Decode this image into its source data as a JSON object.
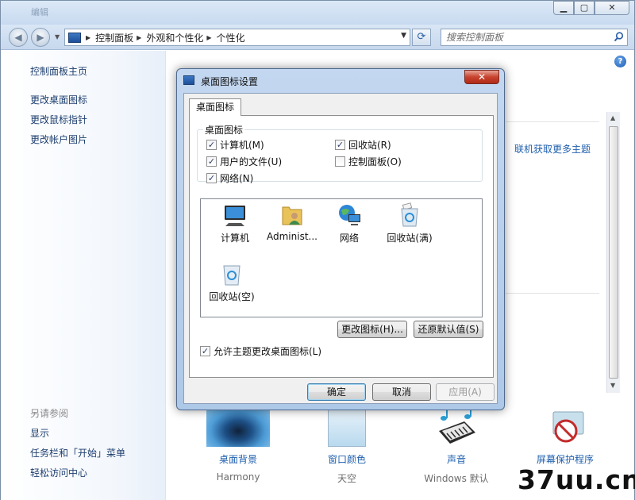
{
  "window": {
    "title": "编辑",
    "minimize": "▁",
    "maximize": "▢",
    "close": "✕"
  },
  "nav": {
    "back": "◀",
    "forward": "▶",
    "breadcrumb": [
      "控制面板",
      "外观和个性化",
      "个性化"
    ],
    "search_placeholder": "搜索控制面板",
    "refresh": "⟳"
  },
  "sidebar": {
    "links": [
      "控制面板主页",
      "更改桌面图标",
      "更改鼠标指针",
      "更改帐户图片"
    ],
    "see_also_heading": "另请参阅",
    "see_also": [
      "显示",
      "任务栏和「开始」菜单",
      "轻松访问中心"
    ]
  },
  "content": {
    "theme_link": "联机获取更多主题",
    "help": "?",
    "bottom": [
      {
        "label": "桌面背景",
        "sub": "Harmony"
      },
      {
        "label": "窗口颜色",
        "sub": "天空"
      },
      {
        "label": "声音",
        "sub": "Windows 默认"
      },
      {
        "label": "屏幕保护程序",
        "sub": ""
      }
    ]
  },
  "watermark": "37uu.cn",
  "dialog": {
    "title": "桌面图标设置",
    "close": "✕",
    "tab": "桌面图标",
    "group_title": "桌面图标",
    "checkboxes": [
      {
        "label": "计算机(M)",
        "checked": true
      },
      {
        "label": "回收站(R)",
        "checked": true
      },
      {
        "label": "用户的文件(U)",
        "checked": true
      },
      {
        "label": "控制面板(O)",
        "checked": false
      },
      {
        "label": "网络(N)",
        "checked": true
      }
    ],
    "icons": [
      "计算机",
      "Administ...",
      "网络",
      "回收站(满)",
      "回收站(空)"
    ],
    "change_icon": "更改图标(H)...",
    "restore_default": "还原默认值(S)",
    "allow_theme": {
      "label": "允许主题更改桌面图标(L)",
      "checked": true
    },
    "ok": "确定",
    "cancel": "取消",
    "apply": "应用(A)"
  }
}
